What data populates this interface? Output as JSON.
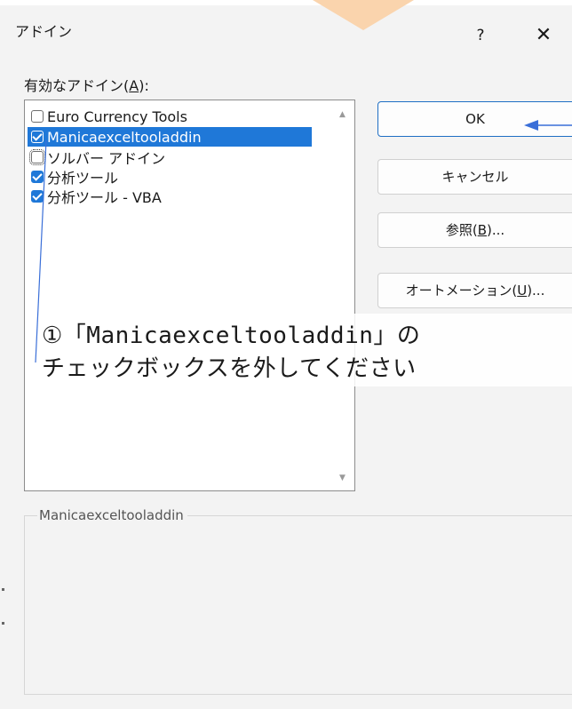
{
  "dialog": {
    "title": "アドイン",
    "help_label": "?",
    "close_label": "✕"
  },
  "list": {
    "label_prefix": "有効なアドイン(",
    "label_accel": "A",
    "label_suffix": "):",
    "scroll_up": "▲",
    "scroll_down": "▼",
    "items": [
      {
        "label": "Euro Currency Tools",
        "checked": false
      },
      {
        "label": "Manicaexceltooladdin",
        "checked": true,
        "selected": true
      },
      {
        "label": "ソルバー アドイン",
        "checked": false
      },
      {
        "label": "分析ツール",
        "checked": true
      },
      {
        "label": "分析ツール - VBA",
        "checked": true
      }
    ]
  },
  "buttons": {
    "ok": "OK",
    "cancel": "キャンセル",
    "browse_prefix": "参照(",
    "browse_accel": "B",
    "browse_suffix": ")...",
    "automation_prefix": "オートメーション(",
    "automation_accel": "U",
    "automation_suffix": ")..."
  },
  "description": {
    "legend": "Manicaexceltooladdin"
  },
  "annotation": {
    "line1": "①「Manicaexceltooladdin」の",
    "line2": "チェックボックスを外してください"
  },
  "colors": {
    "accent": "#1f78d8",
    "annotation_arrow": "#3a6fd8",
    "pointer": "#fad4ad"
  }
}
